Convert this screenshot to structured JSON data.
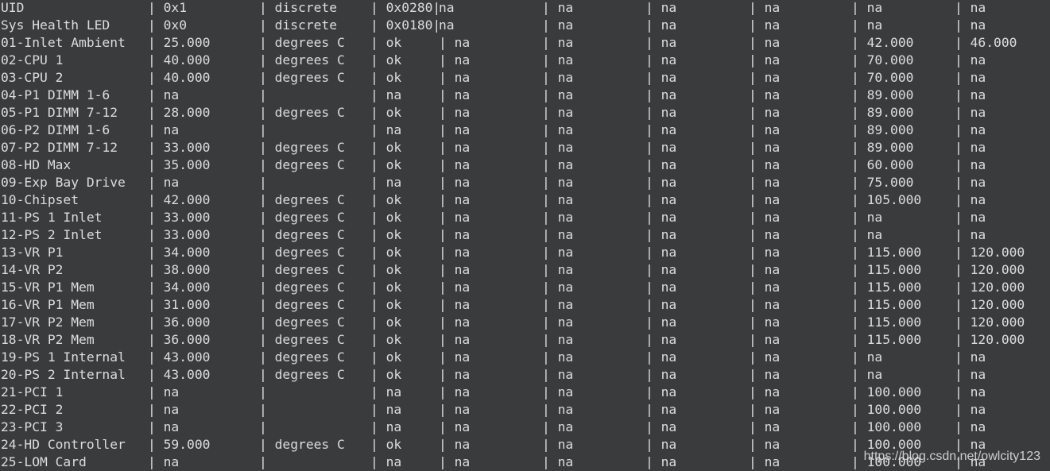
{
  "rows": [
    [
      "UID",
      "| 0x1",
      "| discrete",
      "| 0x0280|",
      "na",
      "| na",
      "| na",
      "| na",
      "| na",
      "| na"
    ],
    [
      "Sys Health LED",
      "| 0x0",
      "| discrete",
      "| 0x0180|",
      "na",
      "| na",
      "| na",
      "| na",
      "| na",
      "| na"
    ],
    [
      "01-Inlet Ambient",
      "| 25.000",
      "| degrees C",
      "| ok",
      "| na",
      "| na",
      "| na",
      "| na",
      "| 42.000",
      "| 46.000"
    ],
    [
      "02-CPU 1",
      "| 40.000",
      "| degrees C",
      "| ok",
      "| na",
      "| na",
      "| na",
      "| na",
      "| 70.000",
      "| na"
    ],
    [
      "03-CPU 2",
      "| 40.000",
      "| degrees C",
      "| ok",
      "| na",
      "| na",
      "| na",
      "| na",
      "| 70.000",
      "| na"
    ],
    [
      "04-P1 DIMM 1-6",
      "| na",
      "|",
      "| na",
      "| na",
      "| na",
      "| na",
      "| na",
      "| 89.000",
      "| na"
    ],
    [
      "05-P1 DIMM 7-12",
      "| 28.000",
      "| degrees C",
      "| ok",
      "| na",
      "| na",
      "| na",
      "| na",
      "| 89.000",
      "| na"
    ],
    [
      "06-P2 DIMM 1-6",
      "| na",
      "|",
      "| na",
      "| na",
      "| na",
      "| na",
      "| na",
      "| 89.000",
      "| na"
    ],
    [
      "07-P2 DIMM 7-12",
      "| 33.000",
      "| degrees C",
      "| ok",
      "| na",
      "| na",
      "| na",
      "| na",
      "| 89.000",
      "| na"
    ],
    [
      "08-HD Max",
      "| 35.000",
      "| degrees C",
      "| ok",
      "| na",
      "| na",
      "| na",
      "| na",
      "| 60.000",
      "| na"
    ],
    [
      "09-Exp Bay Drive",
      "| na",
      "|",
      "| na",
      "| na",
      "| na",
      "| na",
      "| na",
      "| 75.000",
      "| na"
    ],
    [
      "10-Chipset",
      "| 42.000",
      "| degrees C",
      "| ok",
      "| na",
      "| na",
      "| na",
      "| na",
      "| 105.000",
      "| na"
    ],
    [
      "11-PS 1 Inlet",
      "| 33.000",
      "| degrees C",
      "| ok",
      "| na",
      "| na",
      "| na",
      "| na",
      "| na",
      "| na"
    ],
    [
      "12-PS 2 Inlet",
      "| 33.000",
      "| degrees C",
      "| ok",
      "| na",
      "| na",
      "| na",
      "| na",
      "| na",
      "| na"
    ],
    [
      "13-VR P1",
      "| 34.000",
      "| degrees C",
      "| ok",
      "| na",
      "| na",
      "| na",
      "| na",
      "| 115.000",
      "| 120.000"
    ],
    [
      "14-VR P2",
      "| 38.000",
      "| degrees C",
      "| ok",
      "| na",
      "| na",
      "| na",
      "| na",
      "| 115.000",
      "| 120.000"
    ],
    [
      "15-VR P1 Mem",
      "| 34.000",
      "| degrees C",
      "| ok",
      "| na",
      "| na",
      "| na",
      "| na",
      "| 115.000",
      "| 120.000"
    ],
    [
      "16-VR P1 Mem",
      "| 31.000",
      "| degrees C",
      "| ok",
      "| na",
      "| na",
      "| na",
      "| na",
      "| 115.000",
      "| 120.000"
    ],
    [
      "17-VR P2 Mem",
      "| 36.000",
      "| degrees C",
      "| ok",
      "| na",
      "| na",
      "| na",
      "| na",
      "| 115.000",
      "| 120.000"
    ],
    [
      "18-VR P2 Mem",
      "| 36.000",
      "| degrees C",
      "| ok",
      "| na",
      "| na",
      "| na",
      "| na",
      "| 115.000",
      "| 120.000"
    ],
    [
      "19-PS 1 Internal",
      "| 43.000",
      "| degrees C",
      "| ok",
      "| na",
      "| na",
      "| na",
      "| na",
      "| na",
      "| na"
    ],
    [
      "20-PS 2 Internal",
      "| 43.000",
      "| degrees C",
      "| ok",
      "| na",
      "| na",
      "| na",
      "| na",
      "| na",
      "| na"
    ],
    [
      "21-PCI 1",
      "| na",
      "|",
      "| na",
      "| na",
      "| na",
      "| na",
      "| na",
      "| 100.000",
      "| na"
    ],
    [
      "22-PCI 2",
      "| na",
      "|",
      "| na",
      "| na",
      "| na",
      "| na",
      "| na",
      "| 100.000",
      "| na"
    ],
    [
      "23-PCI 3",
      "| na",
      "|",
      "| na",
      "| na",
      "| na",
      "| na",
      "| na",
      "| 100.000",
      "| na"
    ],
    [
      "24-HD Controller",
      "| 59.000",
      "| degrees C",
      "| ok",
      "| na",
      "| na",
      "| na",
      "| na",
      "| 100.000",
      "| na"
    ],
    [
      "25-LOM Card",
      "| na",
      "|",
      "| na",
      "| na",
      "| na",
      "| na",
      "| na",
      "| 100.000",
      "| na"
    ]
  ],
  "watermark": "https://blog.csdn.net/owlcity123",
  "colors": {
    "background": "#3a3b3d",
    "text": "#dcdcdc"
  }
}
